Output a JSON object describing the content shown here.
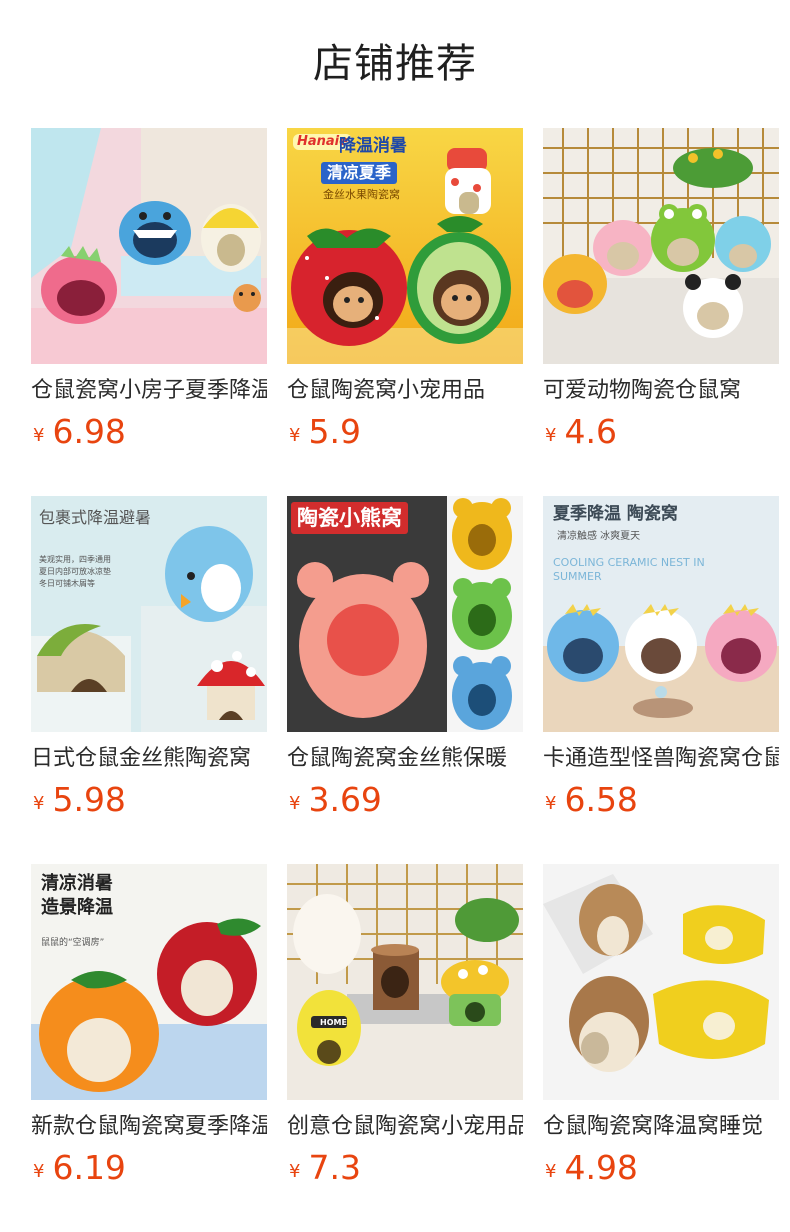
{
  "page": {
    "title": "店铺推荐"
  },
  "currency": "¥",
  "products": [
    {
      "name": "仓鼠瓷窝小房子夏季降温",
      "price": "6.98",
      "image": "cute-shark-ceramic-hamster-houses",
      "banner": "",
      "subtext": ""
    },
    {
      "name": "仓鼠陶瓷窝小宠用品",
      "price": "5.9",
      "image": "strawberry-watermelon-hamster-houses",
      "banner": "降温消暑",
      "banner2": "清凉夏季",
      "subtext": "金丝水果陶瓷窝",
      "brand": "Hanaie"
    },
    {
      "name": "可爱动物陶瓷仓鼠窝",
      "price": "4.6",
      "image": "animal-face-ceramic-houses",
      "banner": "",
      "subtext": ""
    },
    {
      "name": "日式仓鼠金丝熊陶瓷窝",
      "price": "5.98",
      "image": "penguin-mushroom-ceramic-houses",
      "banner": "包裹式降温避暑",
      "subtext": "美观实用，四季通用 夏日内部可放冰凉垫 冬日可铺木屑等"
    },
    {
      "name": "仓鼠陶瓷窝金丝熊保暖",
      "price": "3.69",
      "image": "bear-shaped-ceramic-houses",
      "banner": "陶瓷小熊窝",
      "subtext": ""
    },
    {
      "name": "卡通造型怪兽陶瓷窝仓鼠",
      "price": "6.58",
      "image": "cartoon-monster-ceramic-houses",
      "banner": "夏季降温 陶瓷窝",
      "subtext": "清凉触感 冰爽夏天",
      "subtext2": "COOLING CERAMIC NEST IN SUMMER"
    },
    {
      "name": "新款仓鼠陶瓷窝夏季降温",
      "price": "6.19",
      "image": "orange-apple-ceramic-houses",
      "banner": "清凉消暑",
      "banner2": "造景降温",
      "subtext": "鼠鼠的“空调房”"
    },
    {
      "name": "创意仓鼠陶瓷窝小宠用品",
      "price": "7.3",
      "image": "tree-stump-mushroom-houses",
      "banner": "",
      "subtext": "HOME"
    },
    {
      "name": "仓鼠陶瓷窝降温窝睡觉",
      "price": "4.98",
      "image": "walnut-peanut-ceramic-houses",
      "banner": "",
      "subtext": ""
    }
  ],
  "colors": {
    "price": "#e8440f",
    "title": "#1f1f1f",
    "text": "#2b2b2b"
  }
}
